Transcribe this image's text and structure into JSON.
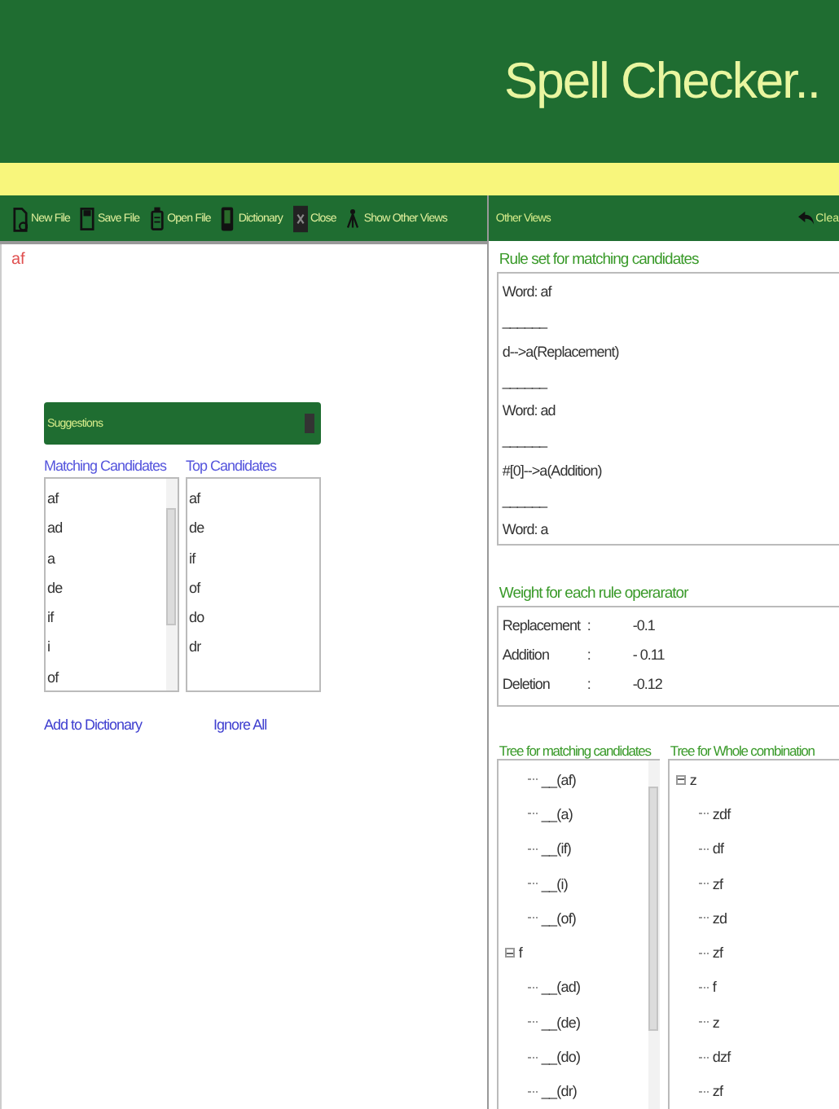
{
  "header": {
    "title": "Spell Checker.."
  },
  "toolbar": {
    "items": [
      {
        "kind": "new",
        "label": "New File"
      },
      {
        "kind": "save",
        "label": "Save File"
      },
      {
        "kind": "open",
        "label": "Open File"
      },
      {
        "kind": "dictionary",
        "label": "Dictionary"
      },
      {
        "kind": "close",
        "label": "Close"
      },
      {
        "kind": "views",
        "label": "Show Other Views"
      }
    ]
  },
  "editor": {
    "text": "af"
  },
  "suggestions": {
    "title": "Suggestions",
    "matching": {
      "label": "Matching Candidates",
      "items": [
        "af",
        "ad",
        "a",
        "de",
        "if",
        "i",
        "of"
      ]
    },
    "top": {
      "label": "Top Candidates",
      "items": [
        "af",
        "de",
        "if",
        "of",
        "do",
        "dr"
      ]
    },
    "actions": [
      "Add to Dictionary",
      "Ignore All"
    ]
  },
  "other_views": {
    "title": "Other Views",
    "clear_label": "Clea"
  },
  "rule_set": {
    "title": "Rule set for matching candidates",
    "lines": [
      "Word: af",
      "______",
      "d-->a(Replacement)",
      "______",
      "Word: ad",
      "______",
      "#[0]-->a(Addition)",
      "______",
      "Word: a"
    ]
  },
  "weights": {
    "title": "Weight for each rule operarator",
    "rows": [
      {
        "name": "Replacement",
        "separator": ":",
        "value": "-0.1"
      },
      {
        "name": "Addition",
        "separator": ":",
        "value": "- 0.11"
      },
      {
        "name": "Deletion",
        "separator": ":",
        "value": "-0.12"
      }
    ]
  },
  "tree_matching": {
    "title": "Tree for matching candidates",
    "nodes": [
      {
        "children": [
          {
            "label": "__(af)"
          },
          {
            "label": "__(a)"
          },
          {
            "label": "__(if)"
          },
          {
            "label": "__(i)"
          },
          {
            "label": "__(of)"
          }
        ]
      },
      {
        "label": "f",
        "expanded": true,
        "children": [
          {
            "label": "__(ad)"
          },
          {
            "label": "__(de)"
          },
          {
            "label": "__(do)"
          },
          {
            "label": "__(dr)"
          }
        ]
      }
    ]
  },
  "tree_whole": {
    "title": "Tree for Whole combination",
    "nodes": [
      {
        "label": "z",
        "expanded": true,
        "children": [
          {
            "label": "zdf"
          },
          {
            "label": "df"
          },
          {
            "label": "zf"
          },
          {
            "label": "zd"
          },
          {
            "label": "zf"
          },
          {
            "label": "f"
          },
          {
            "label": "z"
          },
          {
            "label": "dzf"
          },
          {
            "label": "zf"
          }
        ]
      }
    ]
  }
}
